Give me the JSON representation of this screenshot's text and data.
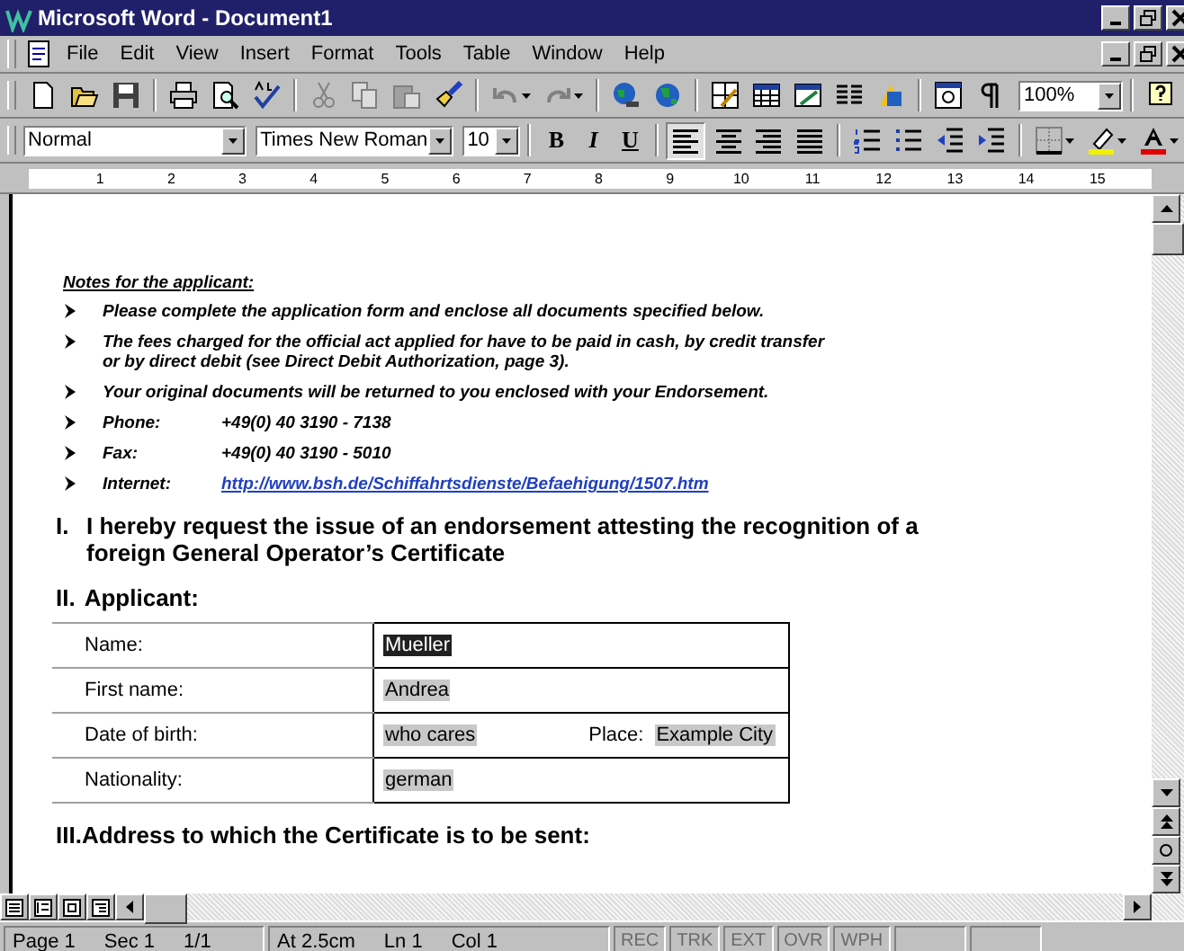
{
  "window": {
    "title": "Microsoft Word - Document1"
  },
  "menu": [
    "File",
    "Edit",
    "View",
    "Insert",
    "Format",
    "Tools",
    "Table",
    "Window",
    "Help"
  ],
  "standard_toolbar": {
    "zoom": "100%"
  },
  "formatting_toolbar": {
    "style": "Normal",
    "font": "Times New Roman",
    "size": "10",
    "format_buttons": [
      "B",
      "I",
      "U"
    ],
    "align_buttons": [
      {
        "selected": true
      },
      {
        "selected": false
      },
      {
        "selected": false
      },
      {
        "selected": false
      }
    ]
  },
  "ruler": {
    "labels": [
      "1",
      "2",
      "3",
      "4",
      "5",
      "6",
      "7",
      "8",
      "9",
      "10",
      "11",
      "12",
      "13",
      "14",
      "15"
    ]
  },
  "document": {
    "notes_heading": "Notes for the applicant:",
    "notes": [
      {
        "kind": "text",
        "text": "Please complete the application form and enclose all documents specified below."
      },
      {
        "kind": "text",
        "text": "The fees charged for the official act applied for have to be paid in cash, by credit transfer or by direct debit (see Direct Debit Authorization, page 3)."
      },
      {
        "kind": "text",
        "text": "Your original documents will be returned to you enclosed with your Endorsement."
      },
      {
        "kind": "contact",
        "label": "Phone:",
        "value": "+49(0) 40 3190 -  7138"
      },
      {
        "kind": "contact",
        "label": "Fax:",
        "value": "+49(0) 40 3190 -  5010"
      },
      {
        "kind": "link",
        "label": "Internet:",
        "value": "http://www.bsh.de/Schiffahrtsdienste/Befaehigung/1507.htm"
      }
    ],
    "sections": [
      {
        "number": "I.",
        "title": "I hereby request the issue of an endorsement attesting the recognition of a foreign General Operator’s Certificate"
      },
      {
        "number": "II.",
        "title": "Applicant:",
        "table": [
          {
            "label": "Name:",
            "parts": [
              {
                "kind": "field",
                "text": "Mueller",
                "selected": true
              }
            ]
          },
          {
            "label": "First name:",
            "parts": [
              {
                "kind": "field",
                "text": "Andrea",
                "selected": false
              }
            ]
          },
          {
            "label": "Date of birth:",
            "parts": [
              {
                "kind": "field",
                "text": "who cares",
                "selected": false
              },
              {
                "kind": "label",
                "text": "Place:"
              },
              {
                "kind": "field",
                "text": "Example City",
                "selected": false
              }
            ]
          },
          {
            "label": "Nationality:",
            "parts": [
              {
                "kind": "field",
                "text": "german",
                "selected": false
              }
            ]
          }
        ]
      },
      {
        "number": "III.",
        "title": "Address to which the Certificate is to be sent:"
      }
    ]
  },
  "status_bar": {
    "fields": [
      "Page 1",
      "Sec 1",
      "1/1",
      "At 2.5cm",
      "Ln 1",
      "Col 1"
    ],
    "indicators": [
      {
        "text": "REC",
        "disabled": true
      },
      {
        "text": "TRK",
        "disabled": true
      },
      {
        "text": "EXT",
        "disabled": true
      },
      {
        "text": "OVR",
        "disabled": true
      },
      {
        "text": "WPH",
        "disabled": true
      }
    ]
  }
}
